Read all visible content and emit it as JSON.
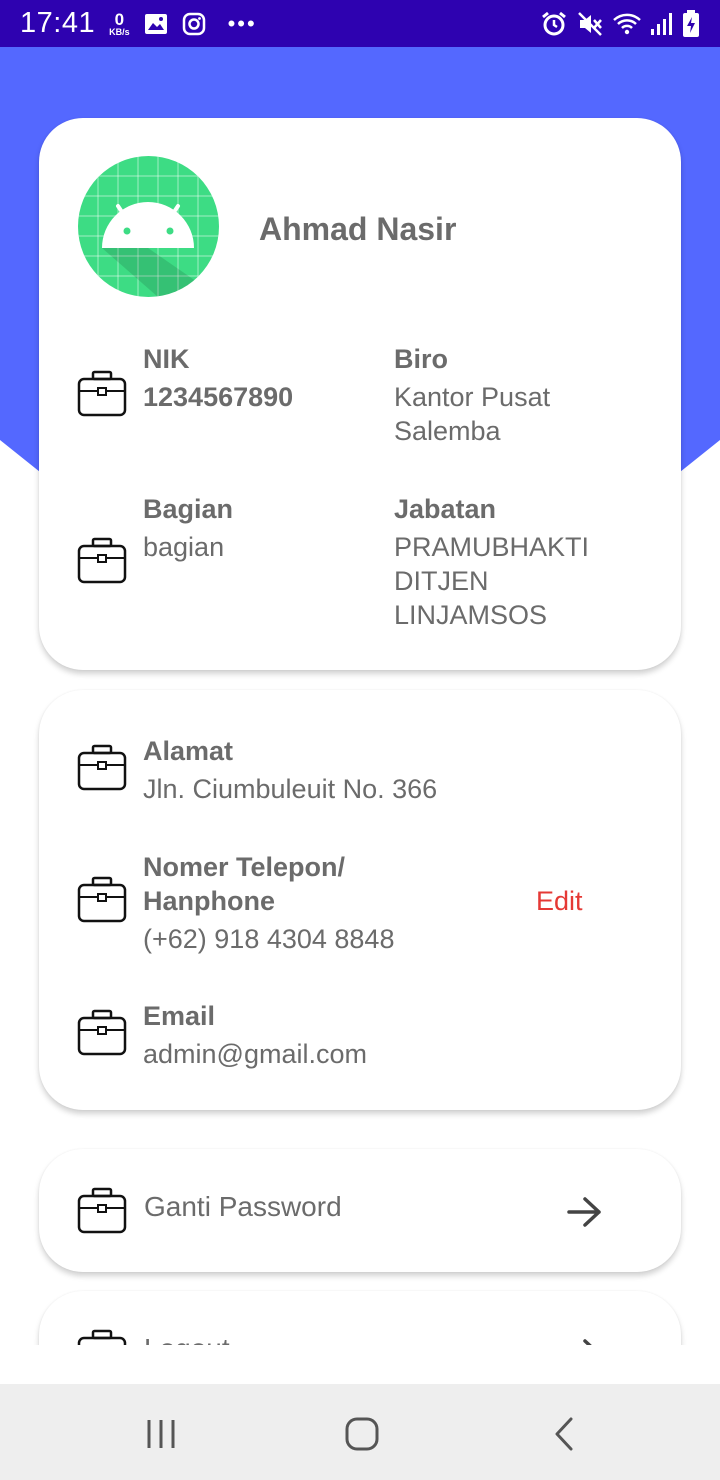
{
  "status_bar": {
    "time": "17:41",
    "net_speed_value": "0",
    "net_speed_unit": "KB/s",
    "icons": [
      "image-icon",
      "instagram-icon",
      "more-dots-icon",
      "alarm-icon",
      "mute-icon",
      "wifi-icon",
      "signal-icon",
      "battery-charging-icon"
    ]
  },
  "profile": {
    "name": "Ahmad Nasir",
    "avatar_icon": "android-icon",
    "avatar_color": "#3ddc84",
    "fields": [
      {
        "label": "NIK",
        "value": "1234567890"
      },
      {
        "label": "Biro",
        "value": "Kantor Pusat\nSalemba"
      },
      {
        "label": "Bagian",
        "value": "bagian"
      },
      {
        "label": "Jabatan",
        "value": "PRAMUBHAKTI\nDITJEN\nLINJAMSOS"
      }
    ]
  },
  "contact": {
    "address_label": "Alamat",
    "address_value": "Jln. Ciumbuleuit No. 366",
    "phone_label": "Nomer Telepon/\nHanphone",
    "phone_value": "(+62) 918 4304 8848",
    "edit_label": "Edit",
    "email_label": "Email",
    "email_value": "admin@gmail.com"
  },
  "actions": {
    "change_password_label": "Ganti Password",
    "logout_label": "Logout"
  },
  "colors": {
    "header_blue": "#5468ff",
    "status_bar": "#2e02b0",
    "edit_red": "#e53935",
    "text_grey": "#6b6b6b"
  }
}
